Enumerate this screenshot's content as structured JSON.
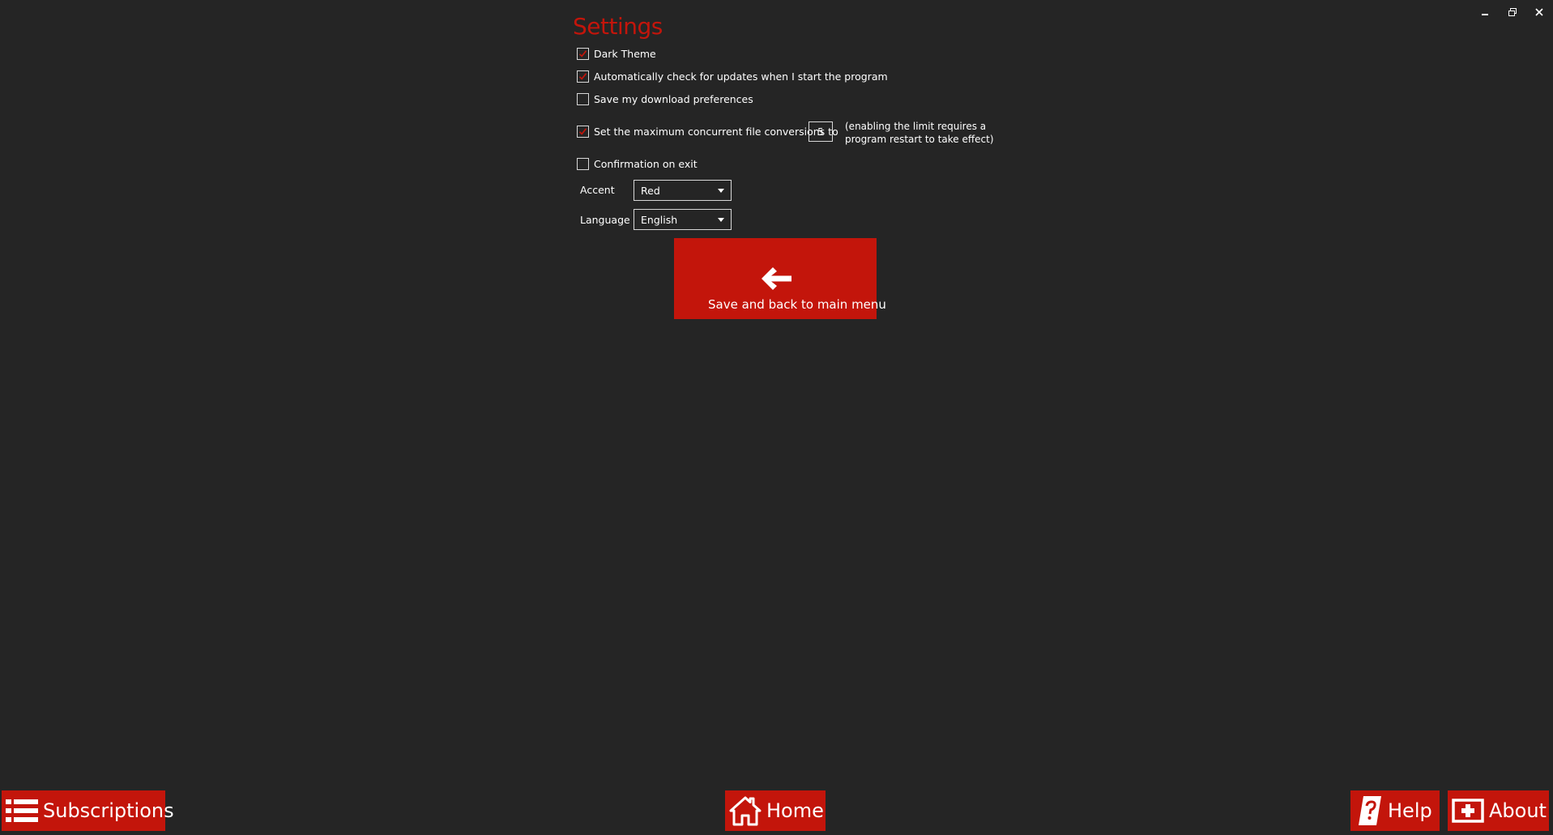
{
  "window": {
    "minimize_icon": "minimize-icon",
    "restore_icon": "restore-icon",
    "close_icon": "close-icon"
  },
  "settings": {
    "title": "Settings",
    "options": [
      {
        "label": "Dark Theme",
        "checked": true
      },
      {
        "label": "Automatically check for updates when I start the program",
        "checked": true
      },
      {
        "label": "Save my download preferences",
        "checked": false
      },
      {
        "label": "Set the maximum concurrent file conversions to",
        "checked": true
      },
      {
        "label": "Confirmation on exit",
        "checked": false
      }
    ],
    "max_conversions_value": "5",
    "max_conversions_note_line1": "(enabling the limit requires a",
    "max_conversions_note_line2": "program restart to take effect)",
    "accent_label": "Accent",
    "accent_value": "Red",
    "language_label": "Language",
    "language_value": "English",
    "save_button_label": "Save and back to main menu"
  },
  "nav": {
    "subscriptions_label": "Subscriptions",
    "home_label": "Home",
    "help_label": "Help",
    "about_label": "About"
  },
  "colors": {
    "accent": "#c3150b",
    "background": "#252525",
    "text": "#ffffff"
  }
}
